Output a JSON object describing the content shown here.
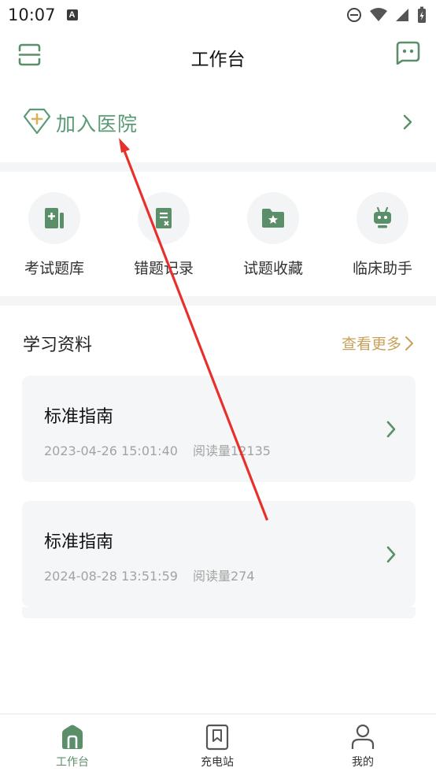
{
  "status_bar": {
    "time": "10:07",
    "app_badge": "A"
  },
  "header": {
    "title": "工作台"
  },
  "join": {
    "label": "加入医院"
  },
  "quick_actions": [
    {
      "label": "考试题库",
      "icon": "question-bank-icon"
    },
    {
      "label": "错题记录",
      "icon": "wrong-answer-record-icon"
    },
    {
      "label": "试题收藏",
      "icon": "favorites-folder-icon"
    },
    {
      "label": "临床助手",
      "icon": "robot-assistant-icon"
    }
  ],
  "materials": {
    "title": "学习资料",
    "more_label": "查看更多",
    "items": [
      {
        "title": "标准指南",
        "date": "2023-04-26 15:01:40",
        "reads": "阅读量12135"
      },
      {
        "title": "标准指南",
        "date": "2024-08-28 13:51:59",
        "reads": "阅读量274"
      }
    ]
  },
  "bottom_nav": [
    {
      "label": "工作台",
      "icon": "home-icon",
      "active": true
    },
    {
      "label": "充电站",
      "icon": "bookmark-icon",
      "active": false
    },
    {
      "label": "我的",
      "icon": "profile-icon",
      "active": false
    }
  ],
  "colors": {
    "accent": "#5b8f6a",
    "join_text": "#5a9a74",
    "more_link": "#c8a25c",
    "annotation": "#e8302a"
  }
}
